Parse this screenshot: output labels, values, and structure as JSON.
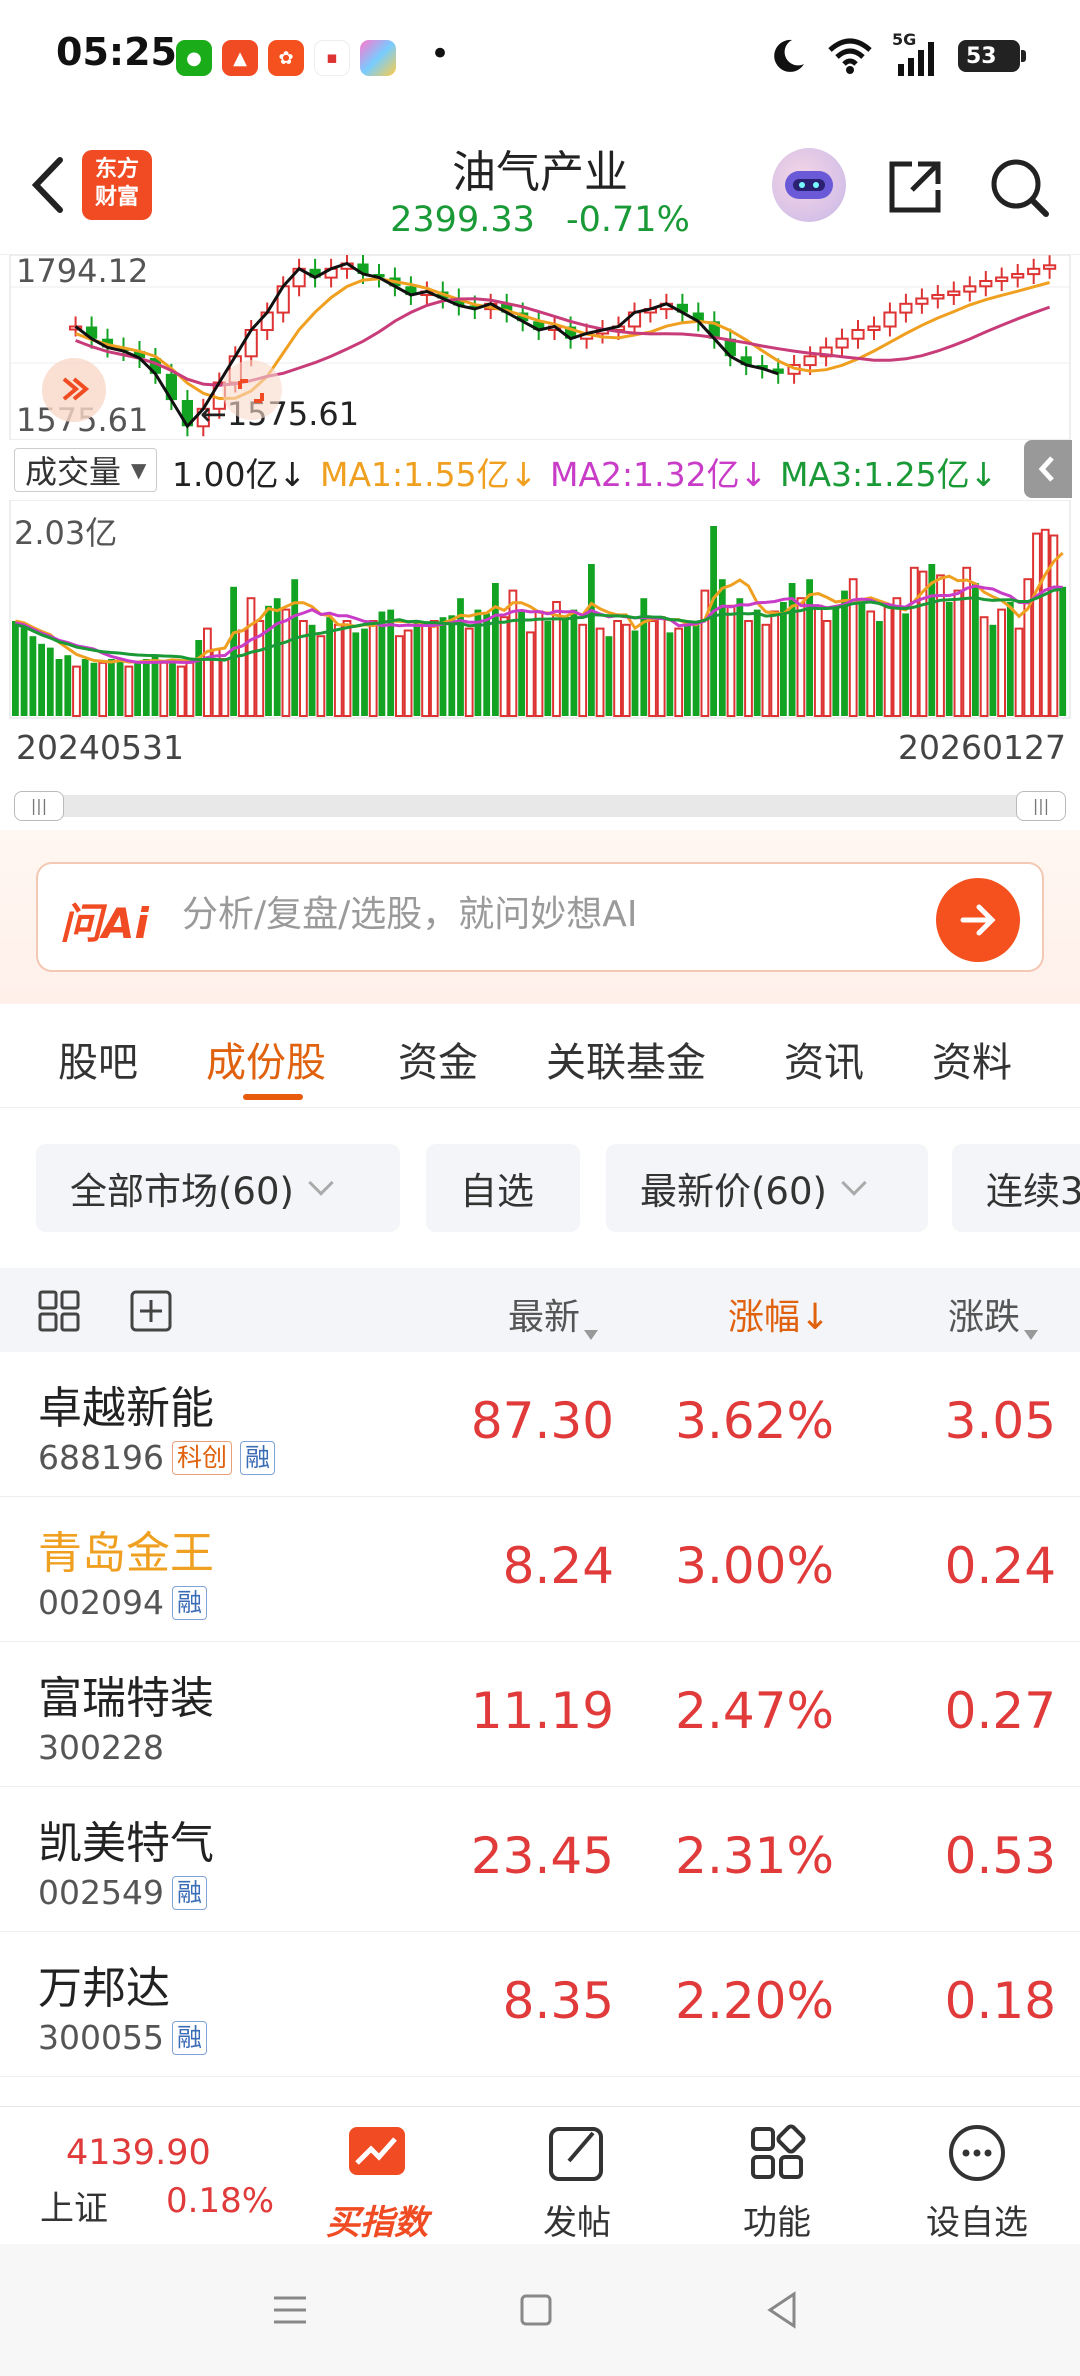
{
  "status": {
    "time": "05:25",
    "battery": "53",
    "signal_label": "5G"
  },
  "header": {
    "brand": "东方\n财富",
    "brand_line1": "东方",
    "brand_line2": "财富",
    "title": "油气产业",
    "price": "2399.33",
    "change_pct": "-0.71%"
  },
  "kline": {
    "high_label": "1794.12",
    "low_label": "1575.61",
    "low_marker": "←1575.61"
  },
  "volume": {
    "selector_label": "成交量",
    "current": "1.00亿↓",
    "ma1": "MA1:1.55亿↓",
    "ma2": "MA2:1.32亿↓",
    "ma3": "MA3:1.25亿↓",
    "max_label": "2.03亿",
    "start_date": "20240531",
    "end_date": "20260127"
  },
  "ai_search": {
    "logo": "问Ai",
    "placeholder": "分析/复盘/选股，就问妙想AI"
  },
  "tabs": [
    {
      "label": "股吧"
    },
    {
      "label": "成份股"
    },
    {
      "label": "资金"
    },
    {
      "label": "关联基金"
    },
    {
      "label": "资讯"
    },
    {
      "label": "资料"
    }
  ],
  "filters": [
    {
      "label": "全部市场(60)"
    },
    {
      "label": "自选"
    },
    {
      "label": "最新价(60)"
    },
    {
      "label": "连续3"
    }
  ],
  "table": {
    "col_latest": "最新",
    "col_pct": "涨幅↓",
    "col_change": "涨跌",
    "rows": [
      {
        "name": "卓越新能",
        "code": "688196",
        "tags": [
          "科创",
          "融"
        ],
        "price": "87.30",
        "pct": "3.62%",
        "chg": "3.05"
      },
      {
        "name": "青岛金王",
        "code": "002094",
        "tags": [
          "融"
        ],
        "price": "8.24",
        "pct": "3.00%",
        "chg": "0.24"
      },
      {
        "name": "富瑞特装",
        "code": "300228",
        "tags": [],
        "price": "11.19",
        "pct": "2.47%",
        "chg": "0.27"
      },
      {
        "name": "凯美特气",
        "code": "002549",
        "tags": [
          "融"
        ],
        "price": "23.45",
        "pct": "2.31%",
        "chg": "0.53"
      },
      {
        "name": "万邦达",
        "code": "300055",
        "tags": [
          "融"
        ],
        "price": "8.35",
        "pct": "2.20%",
        "chg": "0.18"
      }
    ]
  },
  "bottom": {
    "index_value": "4139.90",
    "index_name": "上证",
    "index_pct": "0.18%",
    "buy_index": "买指数",
    "post": "发帖",
    "functions": "功能",
    "add_watch": "设自选"
  },
  "colors": {
    "up_red": "#e03a3a",
    "down_green": "#1a9a36",
    "accent_orange": "#f04b22",
    "ma1": "#f0a020",
    "ma2": "#c83cc8",
    "ma3": "#1a9a36"
  },
  "volume_bars": [
    0.5,
    0.48,
    0.42,
    0.38,
    0.36,
    0.3,
    0.32,
    0.26,
    0.3,
    0.28,
    0.28,
    0.3,
    0.3,
    0.26,
    0.28,
    0.3,
    0.32,
    0.28,
    0.3,
    0.26,
    0.28,
    0.4,
    0.46,
    0.35,
    0.3,
    0.68,
    0.45,
    0.62,
    0.5,
    0.58,
    0.62,
    0.56,
    0.72,
    0.5,
    0.48,
    0.42,
    0.52,
    0.48,
    0.5,
    0.44,
    0.46,
    0.5,
    0.55,
    0.56,
    0.42,
    0.45,
    0.5,
    0.48,
    0.5,
    0.52,
    0.53,
    0.62,
    0.46,
    0.56,
    0.54,
    0.7,
    0.52,
    0.66,
    0.56,
    0.44,
    0.55,
    0.5,
    0.6,
    0.52,
    0.56,
    0.48,
    0.8,
    0.46,
    0.42,
    0.5,
    0.48,
    0.45,
    0.62,
    0.5,
    0.52,
    0.44,
    0.46,
    0.5,
    0.48,
    0.66,
    1.0,
    0.72,
    0.58,
    0.62,
    0.5,
    0.56,
    0.48,
    0.55,
    0.6,
    0.7,
    0.62,
    0.72,
    0.58,
    0.5,
    0.58,
    0.66,
    0.72,
    0.6,
    0.55,
    0.5,
    0.58,
    0.62,
    0.54,
    0.78,
    0.76,
    0.8,
    0.74,
    0.6,
    0.66,
    0.78,
    0.7,
    0.52,
    0.48,
    0.56,
    0.6,
    0.46,
    0.72,
    0.96,
    0.98,
    0.95,
    0.68
  ],
  "volume_up": [
    0,
    0,
    0,
    0,
    0,
    0,
    0,
    1,
    0,
    0,
    1,
    0,
    0,
    1,
    0,
    0,
    0,
    1,
    0,
    1,
    1,
    0,
    1,
    1,
    1,
    0,
    1,
    1,
    1,
    0,
    0,
    1,
    0,
    1,
    0,
    1,
    0,
    1,
    1,
    0,
    0,
    1,
    0,
    0,
    1,
    1,
    0,
    1,
    1,
    0,
    0,
    0,
    1,
    0,
    0,
    0,
    1,
    1,
    0,
    1,
    1,
    0,
    1,
    0,
    0,
    1,
    0,
    1,
    0,
    1,
    1,
    0,
    0,
    1,
    1,
    0,
    1,
    0,
    0,
    1,
    0,
    0,
    1,
    0,
    1,
    0,
    1,
    1,
    0,
    0,
    1,
    0,
    1,
    1,
    0,
    0,
    1,
    0,
    1,
    0,
    1,
    1,
    0,
    1,
    1,
    0,
    1,
    0,
    1,
    1,
    0,
    1,
    0,
    1,
    0,
    1,
    1,
    1,
    1,
    1,
    0
  ],
  "kline_close": [
    0.62,
    0.55,
    0.5,
    0.48,
    0.44,
    0.35,
    0.2,
    0.05,
    0.15,
    0.3,
    0.45,
    0.6,
    0.7,
    0.85,
    0.95,
    0.9,
    0.95,
    0.98,
    0.92,
    0.9,
    0.85,
    0.8,
    0.82,
    0.78,
    0.74,
    0.72,
    0.75,
    0.7,
    0.65,
    0.6,
    0.62,
    0.55,
    0.58,
    0.6,
    0.62,
    0.7,
    0.72,
    0.75,
    0.7,
    0.65,
    0.55,
    0.45,
    0.4,
    0.38,
    0.35,
    0.4,
    0.45,
    0.5,
    0.55,
    0.6,
    0.62,
    0.7,
    0.75,
    0.78,
    0.8,
    0.82,
    0.85,
    0.88,
    0.9,
    0.92,
    0.95,
    0.97
  ]
}
